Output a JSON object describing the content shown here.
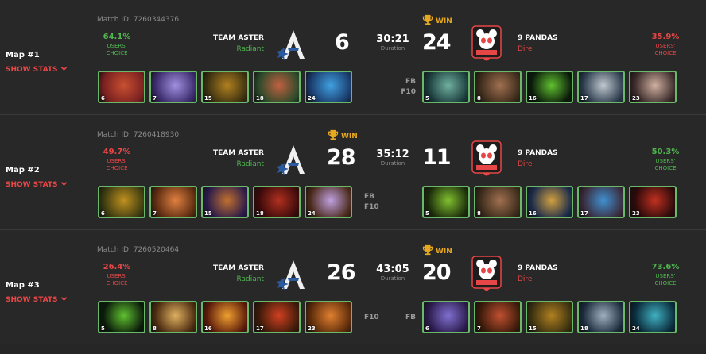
{
  "maps": [
    {
      "title": "Map #1",
      "show_stats": "SHOW STATS",
      "match_id": "Match ID: 7260344376",
      "left": {
        "pct": "64.1%",
        "users_choice": "USERS'\nCHOICE",
        "pct_color": "green",
        "name": "TEAM ASTER",
        "side": "Radiant",
        "score": "6",
        "winner": false
      },
      "right": {
        "pct": "35.9%",
        "users_choice": "USERS'\nCHOICE",
        "pct_color": "red",
        "name": "9 PANDAS",
        "side": "Dire",
        "score": "24",
        "winner": true
      },
      "duration": "30:21",
      "duration_label": "Duration",
      "win_label": "WIN",
      "left_flags": [],
      "right_flags": [
        "FB",
        "F10"
      ],
      "left_heroes": [
        {
          "level": "6",
          "icon": "hero-portrait-1",
          "c1": "#7a2020",
          "c2": "#c85030"
        },
        {
          "level": "7",
          "icon": "hero-portrait-2",
          "c1": "#3a2a6a",
          "c2": "#a090e0"
        },
        {
          "level": "15",
          "icon": "hero-portrait-3",
          "c1": "#3a3010",
          "c2": "#b08020"
        },
        {
          "level": "18",
          "icon": "hero-portrait-4",
          "c1": "#2a4a2a",
          "c2": "#c06040"
        },
        {
          "level": "24",
          "icon": "hero-portrait-5",
          "c1": "#1a3a6a",
          "c2": "#40a0e0"
        }
      ],
      "right_heroes": [
        {
          "level": "5",
          "icon": "hero-portrait-6",
          "c1": "#1a3a3a",
          "c2": "#70b0a0"
        },
        {
          "level": "8",
          "icon": "hero-portrait-7",
          "c1": "#3a2a1a",
          "c2": "#a07050"
        },
        {
          "level": "16",
          "icon": "hero-portrait-8",
          "c1": "#0a1a0a",
          "c2": "#60c030"
        },
        {
          "level": "17",
          "icon": "hero-portrait-9",
          "c1": "#2a3a4a",
          "c2": "#c0c8d0"
        },
        {
          "level": "23",
          "icon": "hero-portrait-10",
          "c1": "#3a2a2a",
          "c2": "#d0b0a0"
        }
      ]
    },
    {
      "title": "Map #2",
      "show_stats": "SHOW STATS",
      "match_id": "Match ID: 7260418930",
      "left": {
        "pct": "49.7%",
        "users_choice": "USERS'\nCHOICE",
        "pct_color": "red",
        "name": "TEAM ASTER",
        "side": "Radiant",
        "score": "28",
        "winner": true
      },
      "right": {
        "pct": "50.3%",
        "users_choice": "USERS'\nCHOICE",
        "pct_color": "green",
        "name": "9 PANDAS",
        "side": "Dire",
        "score": "11",
        "winner": false
      },
      "duration": "35:12",
      "duration_label": "Duration",
      "win_label": "WIN",
      "left_flags": [
        "FB",
        "F10"
      ],
      "right_flags": [],
      "left_heroes": [
        {
          "level": "6",
          "icon": "hero-portrait-11",
          "c1": "#3a3a10",
          "c2": "#c09020"
        },
        {
          "level": "7",
          "icon": "hero-portrait-12",
          "c1": "#5a2a10",
          "c2": "#e08040"
        },
        {
          "level": "15",
          "icon": "hero-portrait-13",
          "c1": "#2a1a4a",
          "c2": "#c07030"
        },
        {
          "level": "18",
          "icon": "hero-portrait-14",
          "c1": "#3a0a0a",
          "c2": "#b03020"
        },
        {
          "level": "24",
          "icon": "hero-portrait-15",
          "c1": "#4a2a1a",
          "c2": "#c0a0e0"
        }
      ],
      "right_heroes": [
        {
          "level": "5",
          "icon": "hero-portrait-16",
          "c1": "#1a2a0a",
          "c2": "#80c030"
        },
        {
          "level": "8",
          "icon": "hero-portrait-17",
          "c1": "#3a2a1a",
          "c2": "#a07050"
        },
        {
          "level": "16",
          "icon": "hero-portrait-18",
          "c1": "#1a2a4a",
          "c2": "#d0a040"
        },
        {
          "level": "17",
          "icon": "hero-portrait-19",
          "c1": "#3a2a3a",
          "c2": "#4090d0"
        },
        {
          "level": "23",
          "icon": "hero-portrait-20",
          "c1": "#2a0a0a",
          "c2": "#c03020"
        }
      ]
    },
    {
      "title": "Map #3",
      "show_stats": "SHOW STATS",
      "match_id": "Match ID: 7260520464",
      "left": {
        "pct": "26.4%",
        "users_choice": "USERS'\nCHOICE",
        "pct_color": "red",
        "name": "TEAM ASTER",
        "side": "Radiant",
        "score": "26",
        "winner": false
      },
      "right": {
        "pct": "73.6%",
        "users_choice": "USERS'\nCHOICE",
        "pct_color": "green",
        "name": "9 PANDAS",
        "side": "Dire",
        "score": "20",
        "winner": true
      },
      "duration": "43:05",
      "duration_label": "Duration",
      "win_label": "WIN",
      "left_flags": [
        "F10"
      ],
      "right_flags": [
        "FB"
      ],
      "left_heroes": [
        {
          "level": "5",
          "icon": "hero-portrait-21",
          "c1": "#0a1a0a",
          "c2": "#60c030"
        },
        {
          "level": "8",
          "icon": "hero-portrait-22",
          "c1": "#4a2a10",
          "c2": "#e0b060"
        },
        {
          "level": "16",
          "icon": "hero-portrait-23",
          "c1": "#5a1a0a",
          "c2": "#f0a030"
        },
        {
          "level": "17",
          "icon": "hero-portrait-24",
          "c1": "#3a1a0a",
          "c2": "#d04020"
        },
        {
          "level": "23",
          "icon": "hero-portrait-25",
          "c1": "#5a2a0a",
          "c2": "#e08030"
        }
      ],
      "right_heroes": [
        {
          "level": "6",
          "icon": "hero-portrait-26",
          "c1": "#2a1a4a",
          "c2": "#8070d0"
        },
        {
          "level": "7",
          "icon": "hero-portrait-27",
          "c1": "#3a1a0a",
          "c2": "#c05030"
        },
        {
          "level": "15",
          "icon": "hero-portrait-28",
          "c1": "#3a3010",
          "c2": "#b08020"
        },
        {
          "level": "18",
          "icon": "hero-portrait-29",
          "c1": "#1a2a3a",
          "c2": "#a0b0c0"
        },
        {
          "level": "24",
          "icon": "hero-portrait-30",
          "c1": "#0a2a3a",
          "c2": "#40b0c0"
        }
      ]
    }
  ],
  "colors": {
    "green": "#4fb64f",
    "red": "#e64646",
    "gold": "#e6a820",
    "hero_border": "#6ab86a"
  }
}
